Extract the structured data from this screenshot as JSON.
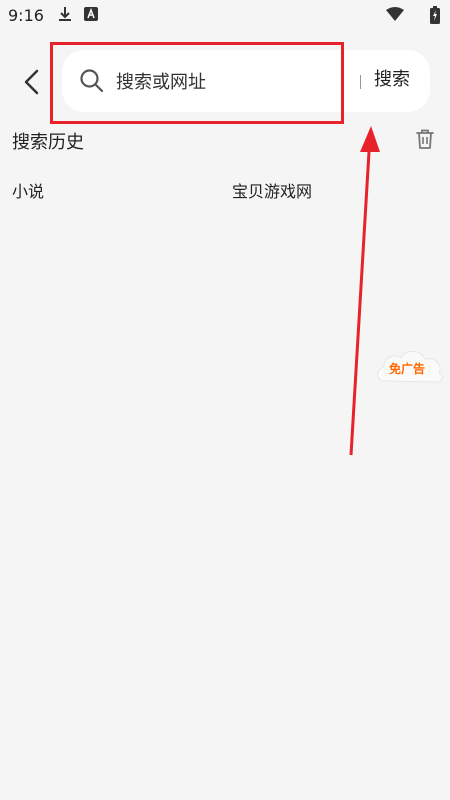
{
  "status_bar": {
    "time": "9:16",
    "icons": [
      "download-icon",
      "a-icon",
      "wifi-icon",
      "battery-icon"
    ]
  },
  "header": {
    "back_icon": "chevron-left-icon",
    "search": {
      "placeholder": "搜索或网址",
      "value": "",
      "icon": "search-icon"
    },
    "submit_label": "搜索"
  },
  "history": {
    "title": "搜索历史",
    "clear_icon": "trash-icon",
    "items": [
      "小说",
      "宝贝游戏网"
    ]
  },
  "ad_badge": {
    "label": "免广告",
    "color": "#ff6a00"
  },
  "annotation": {
    "highlight_color": "#e8222a",
    "arrow_color": "#e8222a"
  }
}
